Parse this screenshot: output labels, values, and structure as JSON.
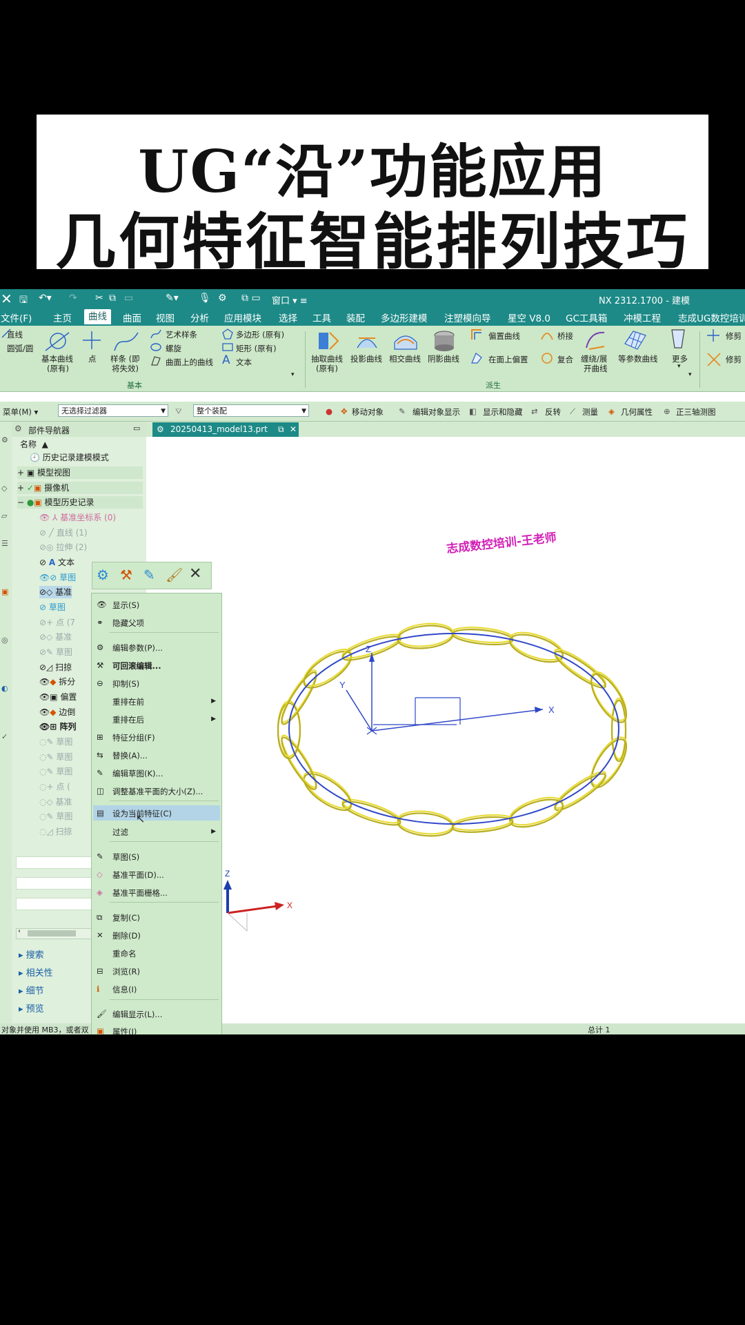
{
  "banner": {
    "line1": "UG“沿”功能应用",
    "line2": "几何特征智能排列技巧"
  },
  "titlebar": {
    "title": "NX 2312.1700 - 建模",
    "window_label": "窗口"
  },
  "menu": {
    "file": "文件(F)",
    "tabs": [
      "主页",
      "曲线",
      "曲面",
      "视图",
      "分析",
      "应用模块",
      "选择",
      "工具",
      "装配",
      "多边形建模",
      "注塑模向导",
      "星空 V8.0",
      "GC工具箱",
      "冲模工程",
      "志成UG数控培训"
    ],
    "active_tab": "曲线"
  },
  "ribbon": {
    "line": "直线",
    "arc": "圆弧/圆",
    "basic_curve": "基本曲线",
    "basic_curve_sub": "(原有)",
    "point": "点",
    "spline": "样条 (即",
    "spline_sub": "将失效)",
    "studio_spline": "艺术样条",
    "helix": "螺旋",
    "curve_on_surface": "曲面上的曲线",
    "polygon": "多边形 (原有)",
    "rectangle": "矩形 (原有)",
    "text": "文本",
    "group_basic": "基本",
    "extract": "抽取曲线",
    "extract_sub": "(原有)",
    "project": "投影曲线",
    "intersect": "相交曲线",
    "shadow": "阴影曲线",
    "offset": "偏置曲线",
    "offset_face": "在面上偏置",
    "bridge": "桥接",
    "composite": "复合",
    "wrap": "缠绕/展",
    "wrap_sub": "开曲线",
    "iso": "等参数曲线",
    "more": "更多",
    "trim": "修剪",
    "trim2": "修剪",
    "group_derived": "派生"
  },
  "selbar": {
    "menu": "菜单(M)",
    "filter": "无选择过滤器",
    "assembly": "整个装配",
    "move_object": "移动对象",
    "edit_display": "编辑对象显示",
    "show_hide": "显示和隐藏",
    "reverse": "反转",
    "measure": "测量",
    "geom_props": "几何属性",
    "trimetric": "正三轴测图"
  },
  "navigator": {
    "title": "部件导航器",
    "col_name": "名称",
    "history_mode": "历史记录建模模式",
    "model_views": "模型视图",
    "cameras": "摄像机",
    "model_history": "模型历史记录",
    "items": [
      "基准坐标系 (0)",
      "直线 (1)",
      "拉伸 (2)",
      "文本",
      "草图",
      "基准",
      "草图",
      "点 (7",
      "基准",
      "草图",
      "扫掠",
      "拆分",
      "偏置",
      "边倒",
      "阵列",
      "草图",
      "草图",
      "草图",
      "点 (",
      "基准",
      "草图",
      "扫掠"
    ],
    "sections": [
      "搜索",
      "相关性",
      "细节",
      "预览"
    ]
  },
  "document_tab": "20250413_model13.prt",
  "viewport": {
    "watermark": "志成数控培训-王老师",
    "axis_x": "X",
    "axis_y": "Y",
    "axis_z": "Z"
  },
  "context_menu": {
    "items": [
      {
        "label": "显示(S)"
      },
      {
        "label": "隐藏父项"
      },
      {
        "label": "编辑参数(P)..."
      },
      {
        "label": "可回滚编辑..."
      },
      {
        "label": "抑制(S)"
      },
      {
        "label": "重排在前"
      },
      {
        "label": "重排在后"
      },
      {
        "label": "特征分组(F)"
      },
      {
        "label": "替换(A)..."
      },
      {
        "label": "编辑草图(K)..."
      },
      {
        "label": "调整基准平面的大小(Z)..."
      },
      {
        "label": "设为当前特征(C)"
      },
      {
        "label": "过滤"
      },
      {
        "label": "草图(S)"
      },
      {
        "label": "基准平面(D)..."
      },
      {
        "label": "基准平面栅格..."
      },
      {
        "label": "复制(C)"
      },
      {
        "label": "删除(D)"
      },
      {
        "label": "重命名"
      },
      {
        "label": "浏览(R)"
      },
      {
        "label": "信息(I)"
      },
      {
        "label": "编辑显示(L)..."
      },
      {
        "label": "属性(I)"
      }
    ],
    "highlighted": "设为当前特征(C)"
  },
  "status": {
    "left": "对象并使用 MB3，或者双",
    "right": "总计 1"
  },
  "colors": {
    "teal": "#1d8a87",
    "ribbon_bg": "#cde8c8",
    "chain_yellow": "#e8dc3a",
    "path_blue": "#2f47c8",
    "watermark": "#d21fb5"
  }
}
